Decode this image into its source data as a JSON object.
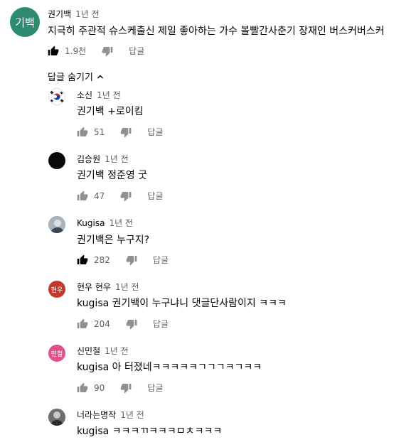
{
  "top_comment": {
    "avatar_text": "기백",
    "avatar_color": "#2e8b6f",
    "author": "권기백",
    "time": "1년 전",
    "text": "지극히 주관적 슈스케출신 제일 좋아하는 가수 볼빨간사춘기 장재인 버스커버스커",
    "likes": "1.9천",
    "reply_label": "답글"
  },
  "hide_replies_label": "답글 숨기기",
  "replies": [
    {
      "author": "소신",
      "time": "1년 전",
      "text": "권기백 +로이킴",
      "likes": "51",
      "reply_label": "답글",
      "avatar_color": "#ffffff",
      "avatar_text": ""
    },
    {
      "author": "김승원",
      "time": "1년 전",
      "text": "권기백 정준영 굿",
      "likes": "47",
      "reply_label": "답글",
      "avatar_color": "#0a0a0a",
      "avatar_text": ""
    },
    {
      "author": "Kugisa",
      "time": "1년 전",
      "text": "권기백은 누구지?",
      "likes": "282",
      "reply_label": "답글",
      "avatar_color": "#8d99a6",
      "avatar_text": ""
    },
    {
      "author": "현우 현우",
      "time": "1년 전",
      "text": "kugisa 권기백이 누구냐니 댓글단사람이지 ㅋㅋㅋ",
      "likes": "204",
      "reply_label": "답글",
      "avatar_color": "#c0392b",
      "avatar_text": "현우"
    },
    {
      "author": "신민철",
      "time": "1년 전",
      "text": "kugisa 아 터졌네ㅋㅋㅋㅋㅋㄱㄱㄱㅋㄱㅋㅋ",
      "likes": "90",
      "reply_label": "답글",
      "avatar_color": "#e0508a",
      "avatar_text": "민철"
    },
    {
      "author": "너라는명작",
      "time": "1년 전",
      "text": "kugisa ㅋㅋㅋㄲㅋㅋㅋㅁㅊㅋㅋㅋ",
      "likes": "",
      "reply_label": "",
      "avatar_color": "#7a7a7a",
      "avatar_text": ""
    }
  ]
}
